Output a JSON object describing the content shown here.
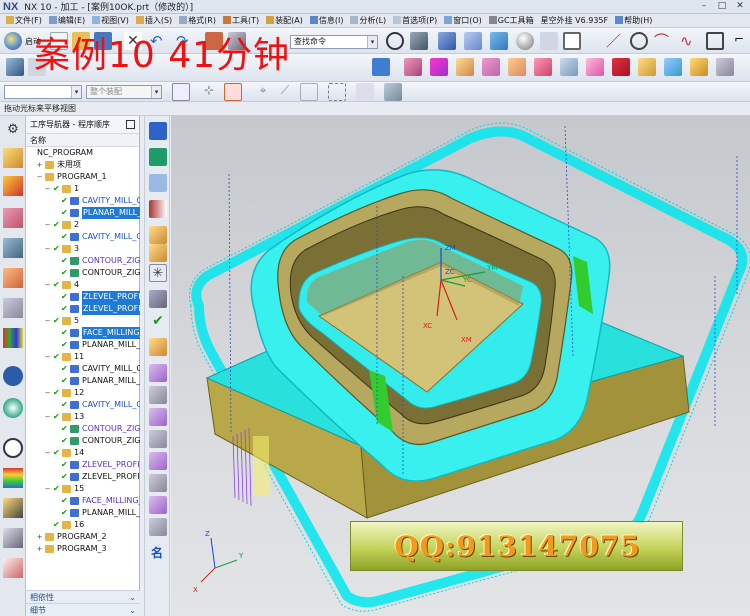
{
  "window": {
    "title": "NX 10 - 加工 - [案例10OK.prt（修改的）]",
    "logo": "NX"
  },
  "menu": {
    "items": [
      "文件(F)",
      "编辑(E)",
      "视图(V)",
      "插入(S)",
      "格式(R)",
      "工具(T)",
      "装配(A)",
      "信息(I)",
      "分析(L)",
      "首选项(P)",
      "窗口(O)",
      "GC工具箱",
      "星空外挂 V6.935F",
      "帮助(H)"
    ]
  },
  "toolbar": {
    "start_label": "启动",
    "command_finder_placeholder": "查找命令",
    "type_filter": "",
    "assembly_filter": "整个装配"
  },
  "overlay_title": "案例10   41分钟",
  "status_line": "拖动光标来平移视图",
  "navigator": {
    "title": "工序导航器 - 程序顺序",
    "column_name": "名称",
    "rows": [
      {
        "label": "NC_PROGRAM",
        "style": "normal"
      },
      {
        "label": "未用项",
        "style": "normal"
      },
      {
        "label": "PROGRAM_1",
        "style": "normal"
      },
      {
        "label": "1",
        "style": "normal"
      },
      {
        "label": "CAVITY_MILL_C",
        "style": "blue"
      },
      {
        "label": "PLANAR_MILL_C",
        "style": "hl"
      },
      {
        "label": "2",
        "style": "normal"
      },
      {
        "label": "CAVITY_MILL_C",
        "style": "blue"
      },
      {
        "label": "3",
        "style": "normal"
      },
      {
        "label": "CONTOUR_ZIGZ",
        "style": "violet"
      },
      {
        "label": "CONTOUR_ZIGZ",
        "style": "normal"
      },
      {
        "label": "4",
        "style": "normal"
      },
      {
        "label": "ZLEVEL_PROFIL",
        "style": "hl"
      },
      {
        "label": "ZLEVEL_PROFIL",
        "style": "hl"
      },
      {
        "label": "5",
        "style": "normal"
      },
      {
        "label": "FACE_MILLING_",
        "style": "hl"
      },
      {
        "label": "PLANAR_MILL_C",
        "style": "normal"
      },
      {
        "label": "11",
        "style": "normal"
      },
      {
        "label": "CAVITY_MILL_C",
        "style": "normal"
      },
      {
        "label": "PLANAR_MILL_C",
        "style": "normal"
      },
      {
        "label": "12",
        "style": "normal"
      },
      {
        "label": "CAVITY_MILL_C",
        "style": "blue"
      },
      {
        "label": "13",
        "style": "normal"
      },
      {
        "label": "CONTOUR_ZIGZ",
        "style": "violet"
      },
      {
        "label": "CONTOUR_ZIGZ",
        "style": "normal"
      },
      {
        "label": "14",
        "style": "normal"
      },
      {
        "label": "ZLEVEL_PROFILI",
        "style": "violet"
      },
      {
        "label": "ZLEVEL_PROFIL",
        "style": "normal"
      },
      {
        "label": "15",
        "style": "normal"
      },
      {
        "label": "FACE_MILLING_",
        "style": "violet"
      },
      {
        "label": "PLANAR_MILL_C",
        "style": "normal"
      },
      {
        "label": "16",
        "style": "normal"
      },
      {
        "label": "PROGRAM_2",
        "style": "normal"
      },
      {
        "label": "PROGRAM_3",
        "style": "normal"
      }
    ],
    "footer": [
      "相依性",
      "细节"
    ]
  },
  "vertical_toolbar": {
    "name_label": "名"
  },
  "graphics": {
    "axis_labels": {
      "zm": "ZM",
      "zc": "ZC",
      "ym": "YM",
      "yc": "YC",
      "xc": "XC",
      "xm": "XM"
    },
    "triad_labels": {
      "z": "Z",
      "x": "X",
      "y": "Y"
    }
  },
  "banner": {
    "text": "QQ:913147075"
  },
  "colors": {
    "toolpath_cyan": "#00ffff",
    "part_olive": "#c7ba64",
    "highlight_blue": "#1e7ad6",
    "overlay_red": "#ee1111",
    "banner_orange": "#f39a1c"
  }
}
